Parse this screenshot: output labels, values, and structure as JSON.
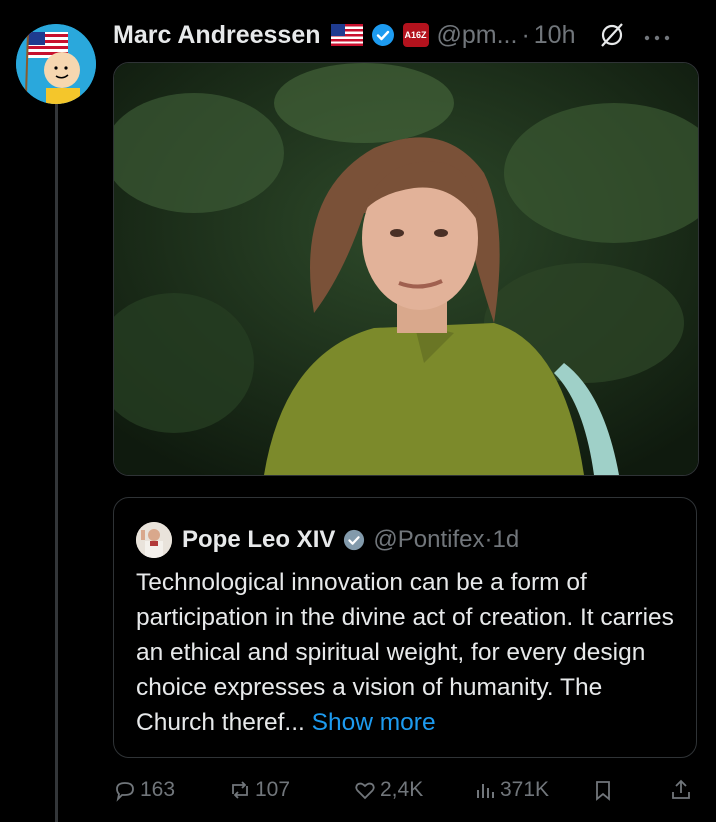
{
  "author": {
    "name": "Marc Andreessen",
    "handle": "@pm...",
    "separator": "·",
    "time": "10h",
    "affiliate_badge": "A16Z"
  },
  "icons": {
    "flag": "us-flag-icon",
    "verified": "verified-badge-icon",
    "grok": "grok-icon",
    "more": "more-dots-icon",
    "reply": "reply-icon",
    "repost": "repost-icon",
    "like": "like-icon",
    "views": "views-icon",
    "bookmark": "bookmark-icon",
    "share": "share-icon"
  },
  "quote": {
    "name": "Pope Leo XIV",
    "handle": "@Pontifex",
    "separator": "·",
    "time": "1d",
    "text": "Technological innovation can be a form of participation in the divine act of creation. It carries an ethical and spiritual weight, for every design choice expresses a vision of humanity. The Church theref...",
    "show_more": "Show more"
  },
  "actions": {
    "replies": "163",
    "reposts": "107",
    "likes": "2,4K",
    "views": "371K"
  },
  "colors": {
    "background": "#000000",
    "accent": "#1d9bf0",
    "muted": "#71767b",
    "border": "#2f3336"
  }
}
